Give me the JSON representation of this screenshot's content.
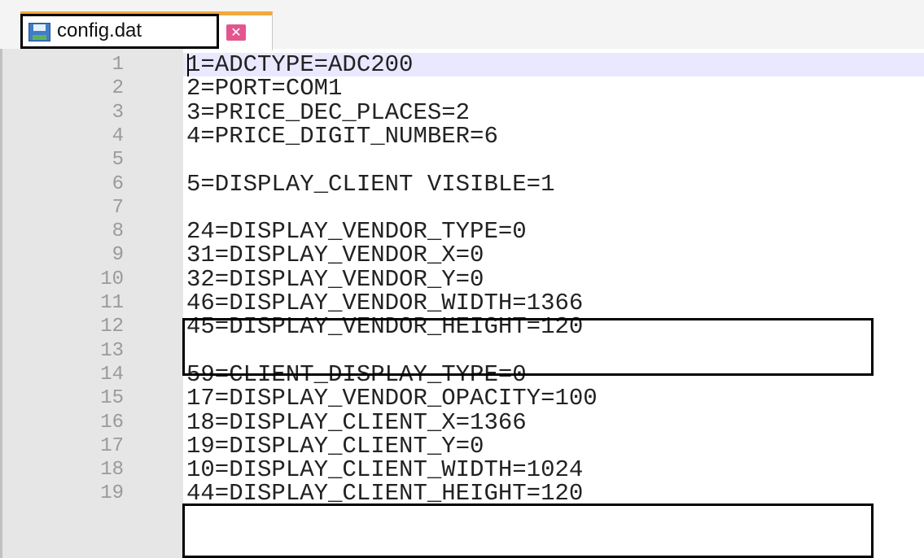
{
  "tab": {
    "filename": "config.dat",
    "close_glyph": "✕",
    "icon": "save-icon"
  },
  "lines": [
    {
      "number": "1",
      "text": "1=ADCTYPE=ADC200"
    },
    {
      "number": "2",
      "text": "2=PORT=COM1"
    },
    {
      "number": "3",
      "text": "3=PRICE_DEC_PLACES=2"
    },
    {
      "number": "4",
      "text": "4=PRICE_DIGIT_NUMBER=6"
    },
    {
      "number": "5",
      "text": ""
    },
    {
      "number": "6",
      "text": "5=DISPLAY_CLIENT VISIBLE=1"
    },
    {
      "number": "7",
      "text": ""
    },
    {
      "number": "8",
      "text": "24=DISPLAY_VENDOR_TYPE=0"
    },
    {
      "number": "9",
      "text": "31=DISPLAY_VENDOR_X=0"
    },
    {
      "number": "10",
      "text": "32=DISPLAY_VENDOR_Y=0"
    },
    {
      "number": "11",
      "text": "46=DISPLAY_VENDOR_WIDTH=1366"
    },
    {
      "number": "12",
      "text": "45=DISPLAY_VENDOR_HEIGHT=120"
    },
    {
      "number": "13",
      "text": ""
    },
    {
      "number": "14",
      "text": "59=CLIENT_DISPLAY_TYPE=0"
    },
    {
      "number": "15",
      "text": "17=DISPLAY_VENDOR_OPACITY=100"
    },
    {
      "number": "16",
      "text": "18=DISPLAY_CLIENT_X=1366"
    },
    {
      "number": "17",
      "text": "19=DISPLAY_CLIENT_Y=0"
    },
    {
      "number": "18",
      "text": "10=DISPLAY_CLIENT_WIDTH=1024"
    },
    {
      "number": "19",
      "text": "44=DISPLAY_CLIENT_HEIGHT=120"
    }
  ],
  "colors": {
    "tab_accent": "#f2a93b",
    "gutter_bg": "#e6e6e6",
    "line_number": "#9a9a9a",
    "current_line": "#e9e8ff",
    "close_button": "#e4558f"
  }
}
